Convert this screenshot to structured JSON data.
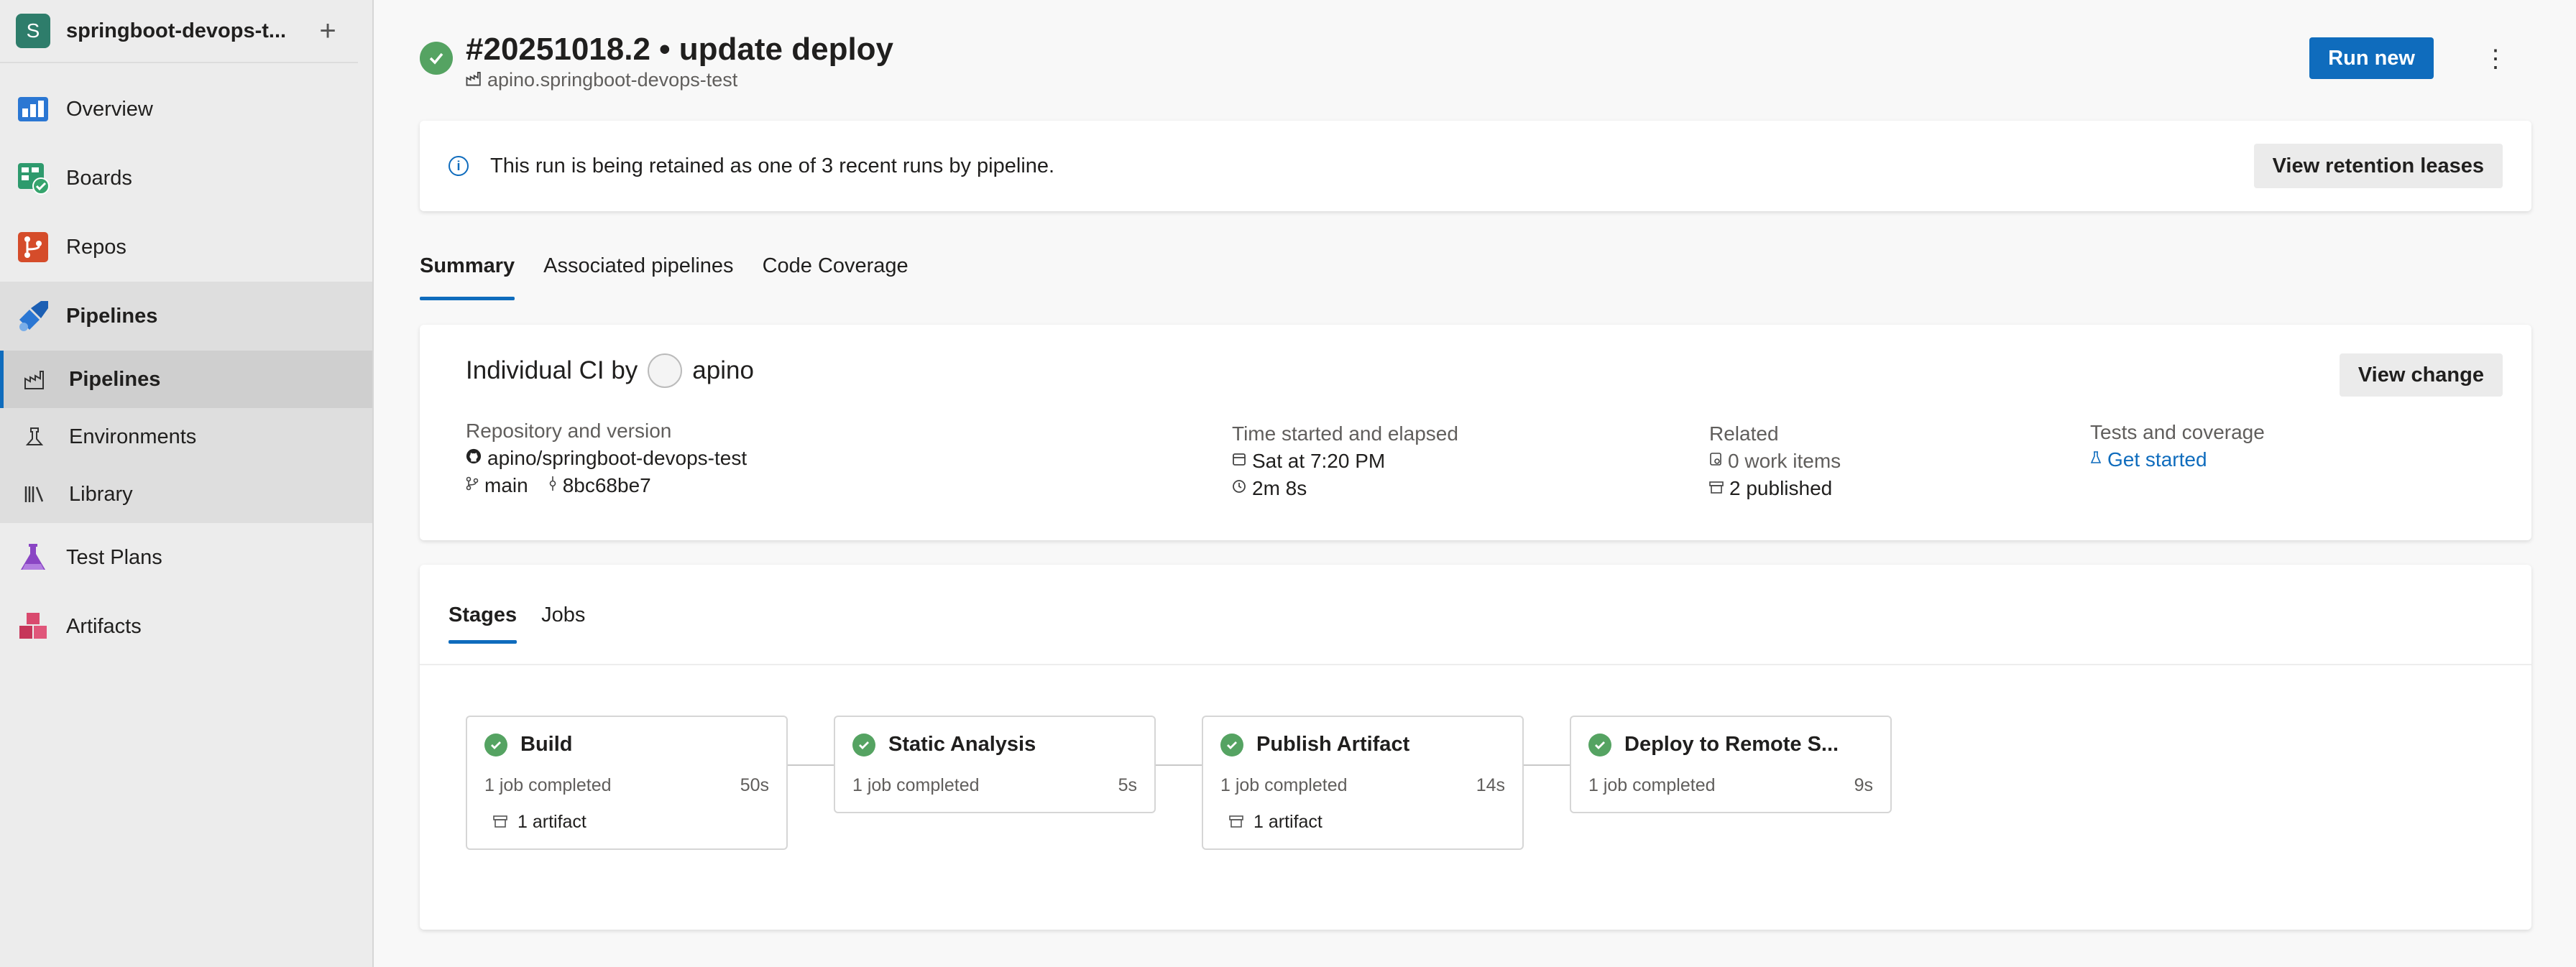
{
  "project": {
    "avatar_letter": "S",
    "name": "springboot-devops-t...",
    "add_label": "+"
  },
  "nav": {
    "overview": "Overview",
    "boards": "Boards",
    "repos": "Repos",
    "pipelines_section": "Pipelines",
    "pipelines_sub": "Pipelines",
    "environments": "Environments",
    "library": "Library",
    "test_plans": "Test Plans",
    "artifacts": "Artifacts"
  },
  "header": {
    "title": "#20251018.2 • update deploy",
    "pipeline_name": "apino.springboot-devops-test",
    "run_new": "Run new",
    "more": "⋮"
  },
  "banner": {
    "message": "This run is being retained as one of 3 recent runs by pipeline.",
    "button": "View retention leases"
  },
  "tabs": [
    "Summary",
    "Associated pipelines",
    "Code Coverage"
  ],
  "summary": {
    "title_prefix": "Individual CI by",
    "user": "apino",
    "view_change": "View change",
    "repo_label": "Repository and version",
    "repo": "apino/springboot-devops-test",
    "branch": "main",
    "commit": "8bc68be7",
    "time_label": "Time started and elapsed",
    "started": "Sat at 7:20 PM",
    "elapsed": "2m 8s",
    "related_label": "Related",
    "work_items": "0 work items",
    "published": "2 published",
    "tests_label": "Tests and coverage",
    "get_started": "Get started"
  },
  "stage_tabs": [
    "Stages",
    "Jobs"
  ],
  "stages": [
    {
      "name": "Build",
      "jobs": "1 job completed",
      "duration": "50s",
      "artifact": "1 artifact"
    },
    {
      "name": "Static Analysis",
      "jobs": "1 job completed",
      "duration": "5s",
      "artifact": ""
    },
    {
      "name": "Publish Artifact",
      "jobs": "1 job completed",
      "duration": "14s",
      "artifact": "1 artifact"
    },
    {
      "name": "Deploy to Remote S...",
      "jobs": "1 job completed",
      "duration": "9s",
      "artifact": ""
    }
  ],
  "colors": {
    "accent": "#0f6cbd",
    "success": "#55a362",
    "project_avatar": "#2e7d6b"
  }
}
